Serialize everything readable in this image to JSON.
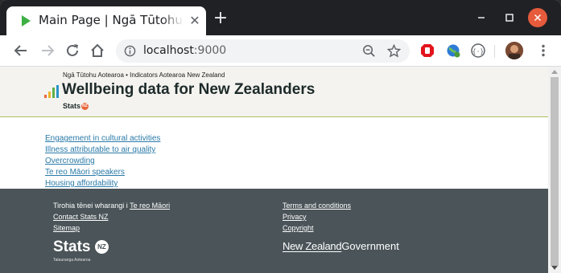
{
  "browser": {
    "tab_title": "Main Page | Ngā Tūtohu Aotearoa",
    "url_host": "localhost",
    "url_port": ":9000",
    "colors": {
      "titlebar": "#202124",
      "close_button": "#e55b3c"
    }
  },
  "header": {
    "breadcrumb": "Ngā Tūtohu Aotearoa • Indicators Aotearoa New Zealand",
    "title": "Wellbeing data for New Zealanders",
    "stats_label": "Stats",
    "stats_badge": "NZ"
  },
  "links": [
    "Engagement in cultural activities",
    "Illness attributable to air quality",
    "Overcrowding",
    "Te reo Māori speakers",
    "Housing affordability"
  ],
  "footer": {
    "language_prefix": "Tirohia tēnei wharangi i",
    "language_link": "Te reo Māori",
    "contact": "Contact Stats NZ",
    "sitemap": "Sitemap",
    "terms": "Terms and conditions",
    "privacy": "Privacy",
    "copyright": "Copyright",
    "stats_logo_word": "Stats",
    "stats_logo_badge": "NZ",
    "stats_logo_sub": "Tatauranga Aotearoa",
    "govt_nz": "New Zealand",
    "govt_word": "Government",
    "colors": {
      "background": "#4a5459",
      "link": "#2a7aa8",
      "accent_line": "#a9c25d"
    }
  }
}
